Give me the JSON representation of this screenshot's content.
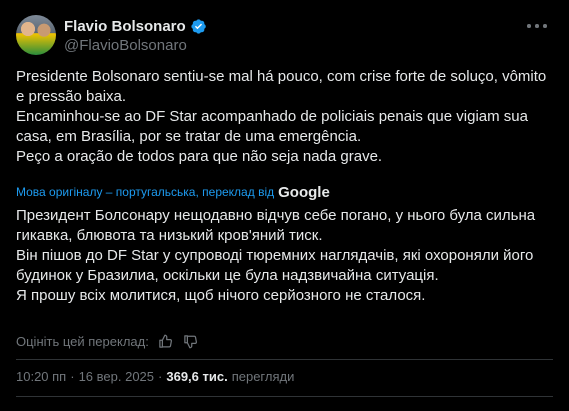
{
  "author": {
    "name": "Flavio Bolsonaro",
    "handle": "@FlavioBolsonaro"
  },
  "tweet": {
    "original_text": "Presidente Bolsonaro sentiu-se mal há pouco, com crise forte de soluço, vômito e pressão baixa.\nEncaminhou-se ao DF Star acompanhado de policiais penais que vigiam sua casa, em Brasília, por se tratar de uma emergência.\nPeço a oração de todos para que não seja nada grave.",
    "translation_note": "Мова оригіналу – португальська, переклад від",
    "translation_provider": "Google",
    "translated_text": "Президент Болсонару нещодавно відчув себе погано, у нього була сильна гикавка, блювота та низький кров'яний тиск.\nВін пішов до DF Star у супроводі тюремних наглядачів, які охороняли його будинок у Бразилиа, оскільки це була надзвичайна ситуація.\nЯ прошу всіх молитися, щоб нічого серйозного не сталося.",
    "rate_translation_label": "Оцініть цей переклад:"
  },
  "meta": {
    "time": "10:20 пп",
    "separator": "·",
    "date": "16 вер. 2025",
    "views_count": "369,6 тис.",
    "views_label": "перегляди"
  },
  "icons": {
    "verified": "verified-badge-icon",
    "more": "more-options-icon",
    "thumbs_up": "thumbs-up-icon",
    "thumbs_down": "thumbs-down-icon"
  },
  "colors": {
    "background": "#000000",
    "text_primary": "#e7e9ea",
    "text_secondary": "#71767b",
    "accent": "#1d9bf0",
    "divider": "#2f3336"
  }
}
